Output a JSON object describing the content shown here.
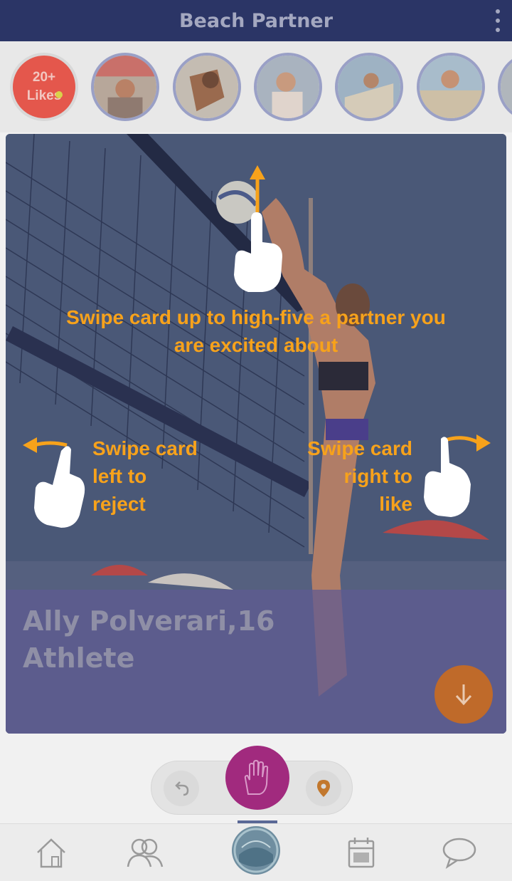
{
  "app": {
    "title": "Beach Partner"
  },
  "stories": {
    "likes_badge": {
      "line1": "20+",
      "line2": "Likes"
    },
    "items": [
      {
        "name": "story-avatar-1"
      },
      {
        "name": "story-avatar-2"
      },
      {
        "name": "story-avatar-3"
      },
      {
        "name": "story-avatar-4"
      },
      {
        "name": "story-avatar-5"
      }
    ]
  },
  "card": {
    "name_age": "Ally Polverari,16",
    "role": "Athlete"
  },
  "tutorial": {
    "up": "Swipe card up to high-five a partner you are excited about",
    "left_lines": [
      "Swipe card",
      "left to",
      "reject"
    ],
    "right_lines": [
      "Swipe card",
      "right to",
      "like"
    ]
  },
  "icons": {
    "menu": "more-vertical-icon",
    "info": "arrow-down-icon",
    "undo": "undo-icon",
    "highfive": "high-five-icon",
    "location": "location-pin-icon",
    "home": "home-icon",
    "people": "people-icon",
    "center": "beach-partner-logo",
    "calendar": "calendar-icon",
    "chat": "chat-icon"
  },
  "colors": {
    "appbar": "#2b3566",
    "tutorial_text": "#f7a21b",
    "highfive": "#a12a7e",
    "info_button": "#bf6a2a",
    "likes_badge": "#e4574c"
  }
}
